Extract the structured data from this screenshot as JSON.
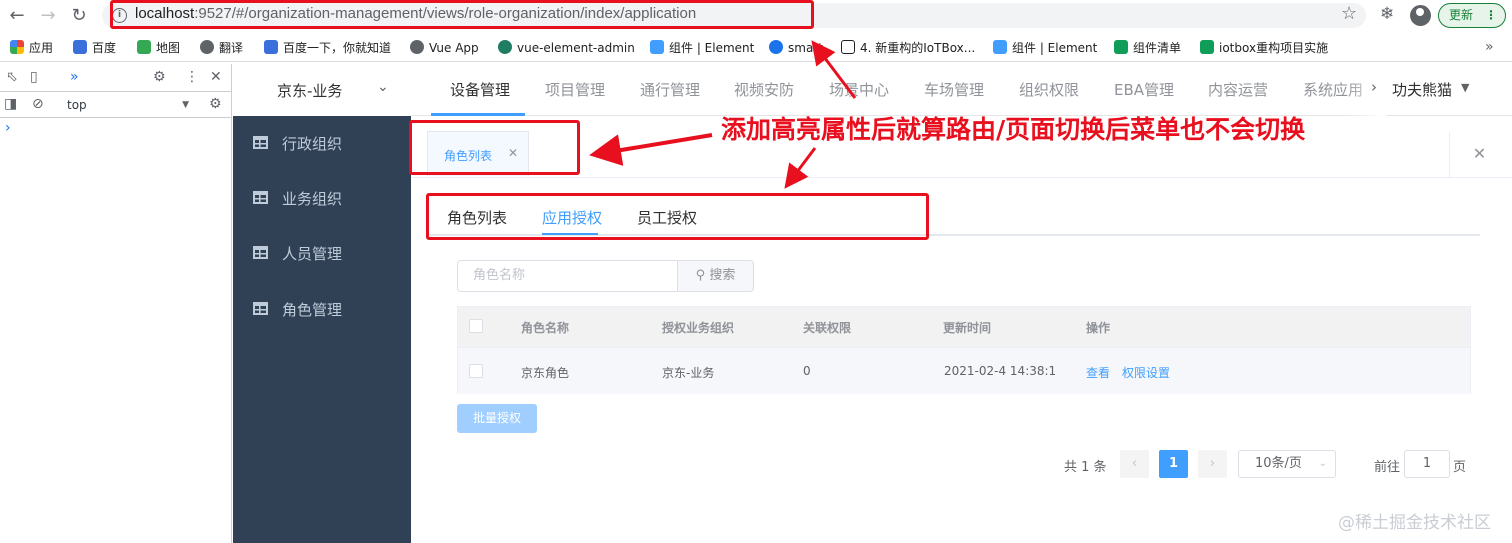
{
  "browser": {
    "url_host": "localhost",
    "url_rest": ":9527/#/organization-management/views/role-organization/index/application",
    "update_label": "更新",
    "bookmarks": [
      {
        "label": "应用",
        "color": "#ea4335"
      },
      {
        "label": "百度",
        "color": "#3b6fdc"
      },
      {
        "label": "地图",
        "color": "#34a853"
      },
      {
        "label": "翻译",
        "color": "#5f6368"
      },
      {
        "label": "百度一下，你就知道",
        "color": "#3b6fdc"
      },
      {
        "label": "Vue App",
        "color": "#5f6368"
      },
      {
        "label": "vue-element-admin",
        "color": "#1e7d62"
      },
      {
        "label": "组件 | Element",
        "color": "#409eff"
      },
      {
        "label": "smart",
        "color": "#1a73e8"
      },
      {
        "label": "4. 新重构的IoTBox...",
        "color": "#202124"
      },
      {
        "label": "组件 | Element",
        "color": "#409eff"
      },
      {
        "label": "组件清单",
        "color": "#0f9d58"
      },
      {
        "label": "iotbox重构项目实施",
        "color": "#0f9d58"
      }
    ]
  },
  "devtools": {
    "context": "top"
  },
  "app": {
    "org_name": "京东-业务",
    "sidebar": [
      {
        "label": "行政组织"
      },
      {
        "label": "业务组织"
      },
      {
        "label": "人员管理"
      },
      {
        "label": "角色管理"
      }
    ],
    "topnav": [
      {
        "label": "设备管理"
      },
      {
        "label": "项目管理"
      },
      {
        "label": "通行管理"
      },
      {
        "label": "视频安防"
      },
      {
        "label": "场景中心"
      },
      {
        "label": "车场管理"
      },
      {
        "label": "组织权限"
      },
      {
        "label": "EBA管理"
      },
      {
        "label": "内容运营"
      },
      {
        "label": "系统应用"
      }
    ],
    "user_name": "功夫熊猫",
    "tag_label": "角色列表",
    "subtabs": [
      {
        "label": "角色列表"
      },
      {
        "label": "应用授权"
      },
      {
        "label": "员工授权"
      }
    ],
    "search": {
      "placeholder": "角色名称",
      "button_label": "搜索"
    },
    "table": {
      "headers": [
        "角色名称",
        "授权业务组织",
        "关联权限",
        "更新时间",
        "操作"
      ],
      "rows": [
        {
          "name": "京东角色",
          "org": "京东-业务",
          "perm": "0",
          "updated": "2021-02-4 14:38:1",
          "action_view": "查看",
          "action_perm": "权限设置"
        }
      ]
    },
    "batch_button": "批量授权",
    "pagination": {
      "total_text": "共 1 条",
      "current_page": "1",
      "page_size": "10条/页",
      "goto_label": "前往",
      "goto_value": "1",
      "page_suffix": "页"
    }
  },
  "annotation": {
    "text": "添加高亮属性后就算路由/页面切换后菜单也不会切换",
    "color": "#e8101e"
  },
  "watermark": "@稀土掘金技术社区"
}
